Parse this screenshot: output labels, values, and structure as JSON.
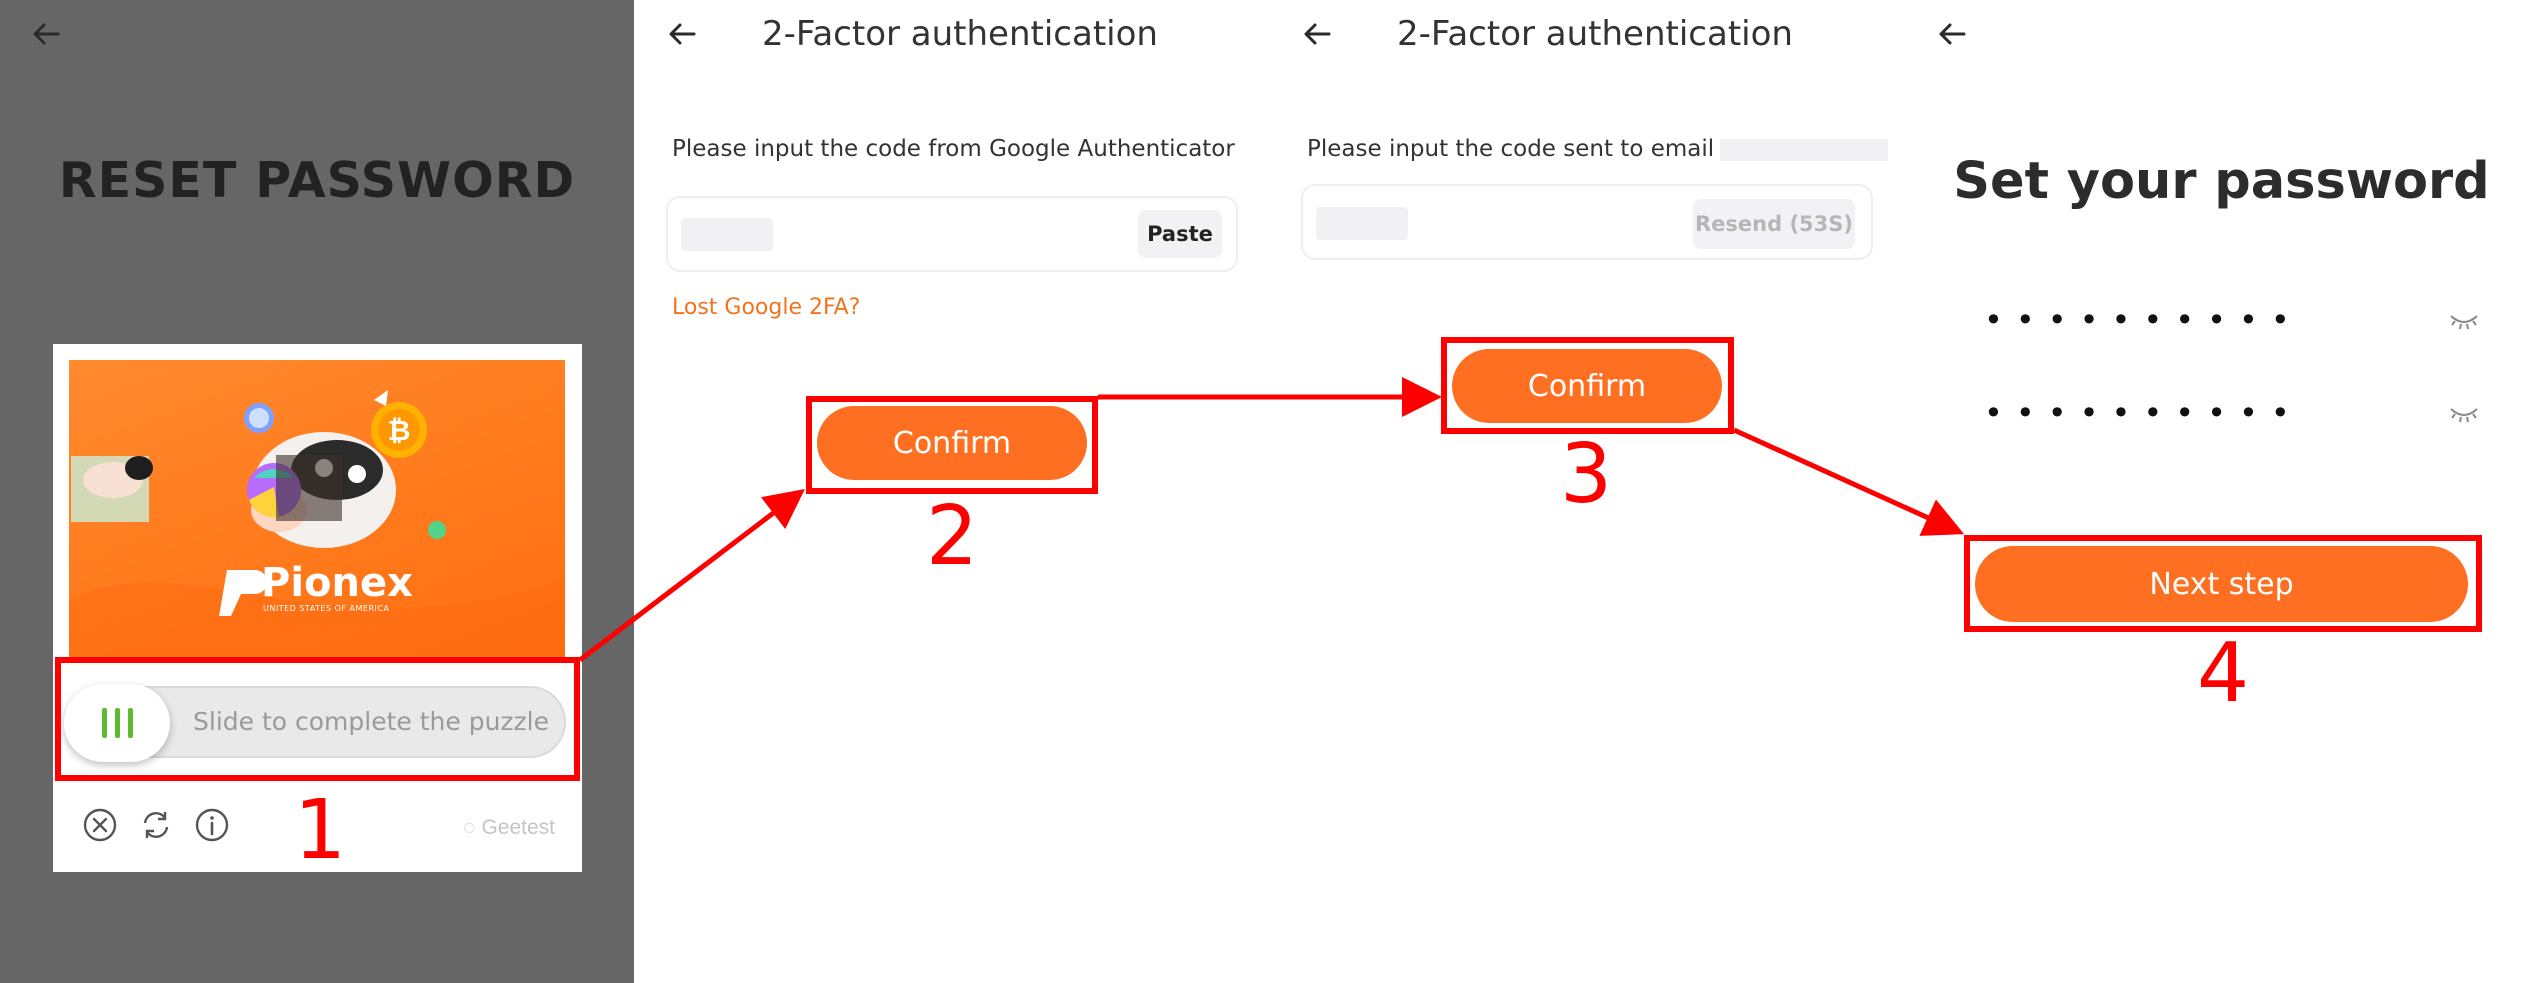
{
  "panel1": {
    "title": "RESET PASSWORD",
    "captcha": {
      "image_brand": "Pionex",
      "image_brand_sub": "UNITED STATES OF AMERICA",
      "slider_hint": "Slide to complete the puzzle",
      "provider": "Geetest",
      "tools": [
        "close-icon",
        "refresh-icon",
        "info-icon"
      ]
    }
  },
  "panel2": {
    "header": "2-Factor authentication",
    "instruction": "Please input the code from Google Authenticator",
    "paste_label": "Paste",
    "lost_link": "Lost Google 2FA?",
    "confirm_label": "Confirm"
  },
  "panel3": {
    "header": "2-Factor authentication",
    "instruction": "Please input the code sent to email",
    "resend_label": "Resend (53S)",
    "confirm_label": "Confirm"
  },
  "panel4": {
    "title": "Set your password",
    "password_mask": "••••••••••",
    "confirm_mask": "••••••••••",
    "next_label": "Next step"
  },
  "annotations": {
    "step1": "1",
    "step2": "2",
    "step3": "3",
    "step4": "4"
  },
  "colors": {
    "accent_orange": "#ff6f22",
    "link_orange": "#f07420",
    "annotation_red": "#ff0000",
    "dim_overlay": "#666666",
    "slider_green": "#5fba2f"
  }
}
